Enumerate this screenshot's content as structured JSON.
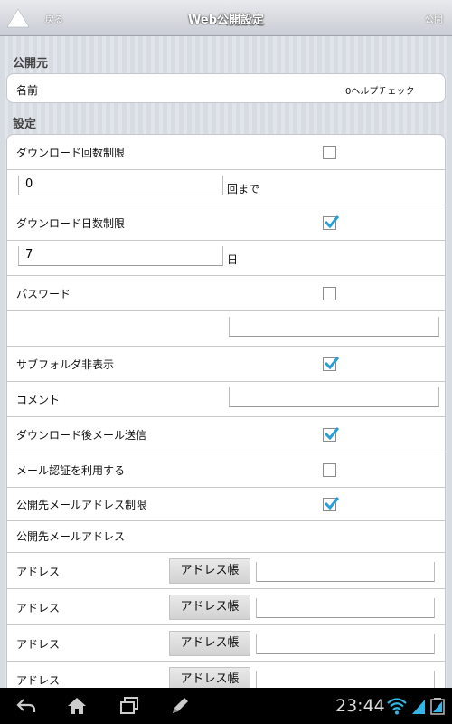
{
  "header": {
    "back": "戻る",
    "title": "Web公開設定",
    "publish": "公開"
  },
  "source_section": {
    "title": "公開元",
    "name_label": "名前",
    "name_value": "0ヘルプチェック"
  },
  "settings_section": {
    "title": "設定",
    "download_count_limit": {
      "label": "ダウンロード回数制限",
      "checked": false,
      "value": "0",
      "unit": "回まで"
    },
    "download_days_limit": {
      "label": "ダウンロード日数制限",
      "checked": true,
      "value": "7",
      "unit": "日"
    },
    "password": {
      "label": "パスワード",
      "checked": false,
      "value": ""
    },
    "hide_subfolders": {
      "label": "サブフォルダ非表示",
      "checked": true
    },
    "comment": {
      "label": "コメント",
      "value": ""
    },
    "mail_after_download": {
      "label": "ダウンロード後メール送信",
      "checked": true
    },
    "mail_auth": {
      "label": "メール認証を利用する",
      "checked": false
    },
    "recipient_address_limit": {
      "label": "公開先メールアドレス制限",
      "checked": true
    },
    "recipient_addresses_header": "公開先メールアドレス",
    "addresses": [
      {
        "label": "アドレス",
        "button": "アドレス帳",
        "value": ""
      },
      {
        "label": "アドレス",
        "button": "アドレス帳",
        "value": ""
      },
      {
        "label": "アドレス",
        "button": "アドレス帳",
        "value": ""
      },
      {
        "label": "アドレス",
        "button": "アドレス帳",
        "value": ""
      }
    ]
  },
  "system_bar": {
    "time": "23:44"
  },
  "colors": {
    "check_blue": "#2a9fd6",
    "nav_background": "#000000",
    "signal_icon": "#33b5e5"
  }
}
